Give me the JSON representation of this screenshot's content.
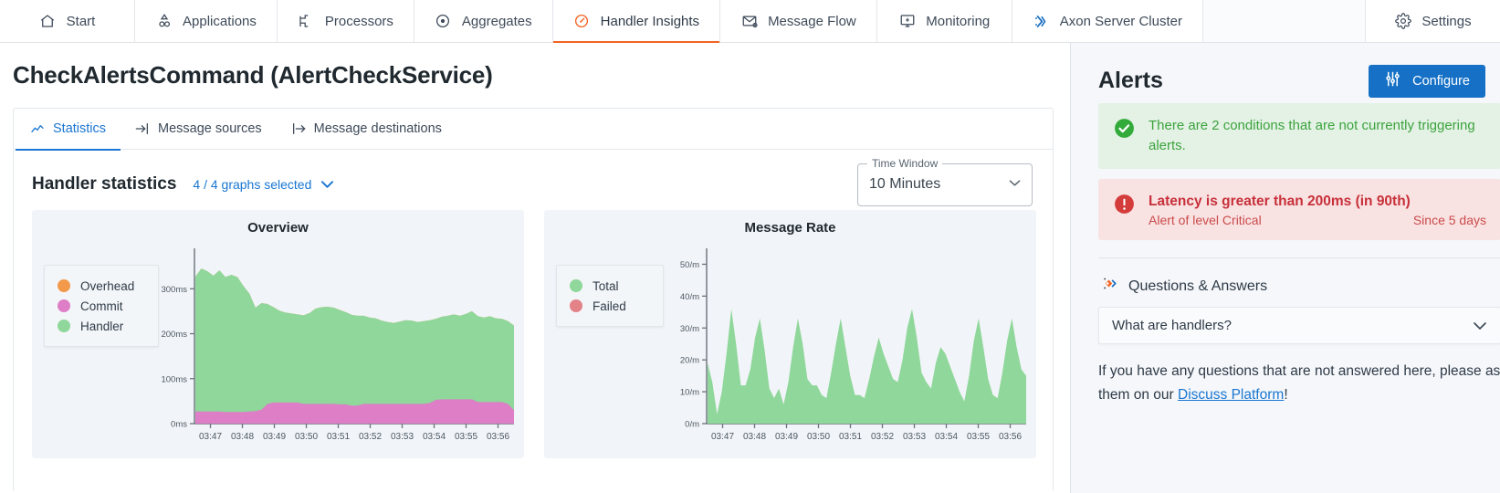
{
  "topnav": {
    "items": [
      {
        "label": "Start",
        "icon": "home-icon",
        "active": false
      },
      {
        "label": "Applications",
        "icon": "applications-icon",
        "active": false
      },
      {
        "label": "Processors",
        "icon": "processors-icon",
        "active": false
      },
      {
        "label": "Aggregates",
        "icon": "aggregates-icon",
        "active": false
      },
      {
        "label": "Handler Insights",
        "icon": "gauge-icon",
        "active": true
      },
      {
        "label": "Message Flow",
        "icon": "envelope-icon",
        "active": false
      },
      {
        "label": "Monitoring",
        "icon": "monitor-icon",
        "active": false
      },
      {
        "label": "Axon Server Cluster",
        "icon": "axon-cluster-icon",
        "active": false
      }
    ],
    "settings": {
      "label": "Settings",
      "icon": "gear-icon"
    },
    "accent_active": "#f26322",
    "accent_cluster": "#1b6ec2"
  },
  "page": {
    "title": "CheckAlertsCommand (AlertCheckService)"
  },
  "subtabs": [
    {
      "label": "Statistics",
      "icon": "chart-line-icon",
      "active": true
    },
    {
      "label": "Message sources",
      "icon": "arrow-into-icon",
      "active": false
    },
    {
      "label": "Message destinations",
      "icon": "arrow-out-icon",
      "active": false
    }
  ],
  "stats": {
    "heading": "Handler statistics",
    "graphs_selected": "4 / 4 graphs selected",
    "chevron": "⌄",
    "time_window": {
      "label": "Time Window",
      "value": "10 Minutes",
      "arrow": "▼"
    }
  },
  "alerts": {
    "title": "Alerts",
    "configure_label": "Configure",
    "configure_color": "#1671c6",
    "ok_alert": {
      "icon": "check-circle-icon",
      "text": "There are 2 conditions that are not currently triggering alerts.",
      "color": "#3da33f",
      "bg": "#e3f2e4"
    },
    "critical_alert": {
      "icon": "exclamation-circle-icon",
      "title": "Latency is greater than 200ms (in 90th)",
      "level": "Alert of level Critical",
      "since": "Since 5 days",
      "color": "#c7303a",
      "bg": "#f9e2e2"
    }
  },
  "qa": {
    "heading": "Questions & Answers",
    "icon": "axon-diamond-icon",
    "items": [
      {
        "label": "What are handlers?",
        "chevron": "⌄"
      }
    ],
    "footer_pre": "If you have any questions that are not answered here, please ask them on our ",
    "footer_link": "Discuss Platform",
    "footer_post": "!"
  },
  "chart_data": [
    {
      "type": "area",
      "title": "Overview",
      "stacked": true,
      "xlabel": "",
      "ylabel": "",
      "ylim": [
        0,
        390
      ],
      "yticks": [
        0,
        100,
        200,
        300
      ],
      "ytick_labels": [
        "0ms",
        "100ms",
        "200ms",
        "300ms"
      ],
      "x": [
        "03:47",
        "03:48",
        "03:49",
        "03:50",
        "03:51",
        "03:52",
        "03:53",
        "03:54",
        "03:55",
        "03:56"
      ],
      "xtick_labels": [
        "03:47",
        "03:48",
        "03:49",
        "03:50",
        "03:51",
        "03:52",
        "03:53",
        "03:54",
        "03:55",
        "03:56"
      ],
      "legend": [
        {
          "name": "Overhead",
          "color": "#f2994a"
        },
        {
          "name": "Commit",
          "color": "#dd7ec6"
        },
        {
          "name": "Handler",
          "color": "#8fd79a"
        }
      ],
      "legend_position": "left",
      "series": [
        {
          "name": "Commit",
          "color": "#dd7ec6",
          "values": [
            27,
            27,
            27,
            27,
            27,
            26,
            26,
            26,
            26,
            27,
            28,
            31,
            44,
            47,
            47,
            47,
            47,
            47,
            44,
            44,
            44,
            44,
            44,
            44,
            43,
            43,
            40,
            40,
            44,
            44,
            44,
            44,
            44,
            44,
            44,
            44,
            44,
            44,
            44,
            46,
            53,
            54,
            54,
            54,
            54,
            54,
            54,
            48,
            48,
            48,
            48,
            48,
            44,
            30
          ]
        },
        {
          "name": "Handler",
          "color": "#8fd79a",
          "values": [
            300,
            318,
            312,
            302,
            314,
            300,
            305,
            300,
            280,
            262,
            230,
            237,
            222,
            212,
            204,
            200,
            198,
            196,
            197,
            202,
            212,
            215,
            216,
            214,
            210,
            205,
            202,
            200,
            196,
            192,
            190,
            185,
            182,
            180,
            183,
            186,
            185,
            182,
            184,
            184,
            180,
            184,
            186,
            189,
            186,
            190,
            196,
            191,
            188,
            191,
            186,
            185,
            184,
            188
          ]
        },
        {
          "name": "Overhead",
          "color": "#f2994a",
          "values": [
            0,
            0,
            0,
            0,
            0,
            0,
            0,
            0,
            0,
            0,
            0,
            0,
            0,
            0,
            0,
            0,
            0,
            0,
            0,
            0,
            0,
            0,
            0,
            0,
            0,
            0,
            0,
            0,
            0,
            0,
            0,
            0,
            0,
            0,
            0,
            0,
            0,
            0,
            0,
            0,
            0,
            0,
            0,
            0,
            0,
            0,
            0,
            0,
            0,
            0,
            0,
            0,
            0,
            0
          ]
        }
      ]
    },
    {
      "type": "area",
      "title": "Message Rate",
      "stacked": false,
      "xlabel": "",
      "ylabel": "",
      "ylim": [
        0,
        55
      ],
      "yticks": [
        0,
        10,
        20,
        30,
        40,
        50
      ],
      "ytick_labels": [
        "0/m",
        "10/m",
        "20/m",
        "30/m",
        "40/m",
        "50/m"
      ],
      "x": [
        "03:47",
        "03:48",
        "03:49",
        "03:50",
        "03:51",
        "03:52",
        "03:53",
        "03:54",
        "03:55",
        "03:56"
      ],
      "xtick_labels": [
        "03:47",
        "03:48",
        "03:49",
        "03:50",
        "03:51",
        "03:52",
        "03:53",
        "03:54",
        "03:55",
        "03:56"
      ],
      "legend": [
        {
          "name": "Total",
          "color": "#8fd79a"
        },
        {
          "name": "Failed",
          "color": "#e38287"
        }
      ],
      "legend_position": "left",
      "series": [
        {
          "name": "Total",
          "color": "#8fd79a",
          "values": [
            19,
            13,
            3,
            10,
            22,
            36,
            25,
            12,
            12,
            17,
            27,
            33,
            23,
            11,
            8,
            11,
            6,
            13,
            24,
            33,
            25,
            14,
            12,
            12,
            9,
            8,
            16,
            25,
            33,
            24,
            15,
            9,
            9,
            8,
            14,
            21,
            27,
            22,
            18,
            14,
            13,
            20,
            30,
            36,
            27,
            16,
            13,
            11,
            19,
            24,
            22,
            18,
            14,
            10,
            7,
            15,
            26,
            33,
            24,
            14,
            9,
            8,
            16,
            26,
            33,
            24,
            17,
            15
          ]
        },
        {
          "name": "Failed",
          "color": "#e38287",
          "values": [
            0,
            0,
            0,
            0,
            0,
            0,
            0,
            0,
            0,
            0,
            0,
            0,
            0,
            0,
            0,
            0,
            0,
            0,
            0,
            0,
            0,
            0,
            0,
            0,
            0,
            0,
            0,
            0,
            0,
            0,
            0,
            0,
            0,
            0,
            0,
            0,
            0,
            0,
            0,
            0,
            0,
            0,
            0,
            0,
            0,
            0,
            0,
            0,
            0,
            0,
            0,
            0,
            0,
            0,
            0,
            0,
            0,
            0,
            0,
            0,
            0,
            0,
            0,
            0,
            0,
            0,
            0,
            0
          ]
        }
      ]
    }
  ]
}
